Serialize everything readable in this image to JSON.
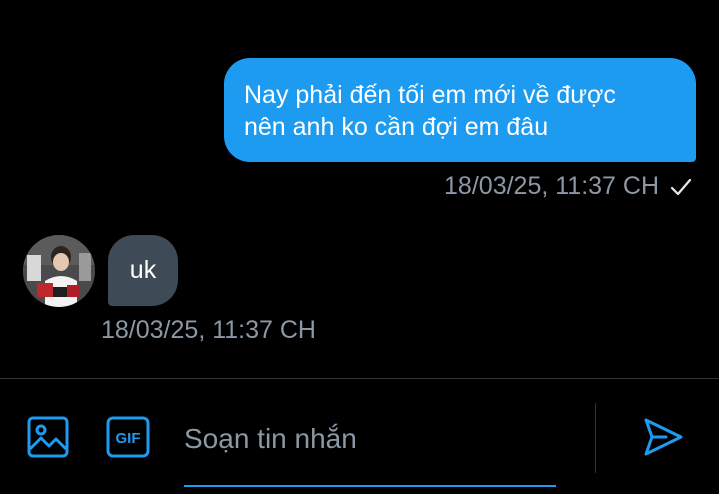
{
  "messages": {
    "outgoing": {
      "text_line1": "Nay phải đến tối em mới về được",
      "text_line2": "nên anh ko cần đợi em đâu",
      "timestamp": "18/03/25, 11:37 CH",
      "status_icon": "check-icon"
    },
    "incoming": {
      "text": "uk",
      "timestamp": "18/03/25, 11:37 CH",
      "avatar_icon": "avatar"
    }
  },
  "composer": {
    "placeholder": "Soạn tin nhắn",
    "value": "",
    "image_icon": "image-icon",
    "gif_icon": "gif-icon",
    "gif_label": "GIF",
    "send_icon": "send-icon"
  },
  "colors": {
    "background": "#000000",
    "accent": "#1d9bf0",
    "incoming_bubble": "#3e4a56",
    "muted_text": "#8b98a5"
  }
}
